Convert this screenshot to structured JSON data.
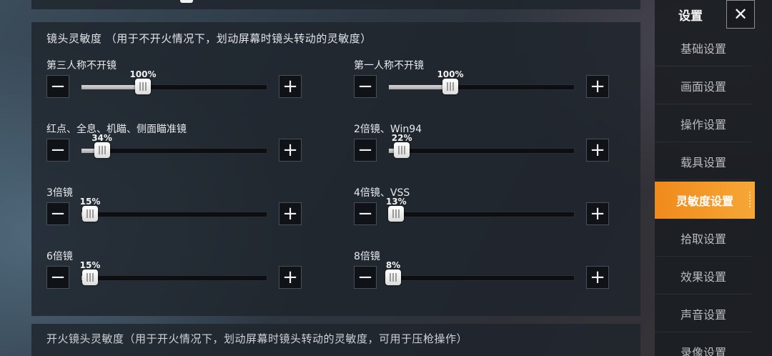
{
  "scope_section": {
    "title": "镜头灵敏度  （用于不开火情况下，划动屏幕时镜头转动的灵敏度）",
    "items": [
      {
        "label": "第三人称不开镜",
        "value": 100,
        "display": "100%"
      },
      {
        "label": "第一人称不开镜",
        "value": 100,
        "display": "100%"
      },
      {
        "label": "红点、全息、机瞄、侧面瞄准镜",
        "value": 34,
        "display": "34%"
      },
      {
        "label": "2倍镜、Win94",
        "value": 22,
        "display": "22%"
      },
      {
        "label": "3倍镜",
        "value": 15,
        "display": "15%"
      },
      {
        "label": "4倍镜、VSS",
        "value": 13,
        "display": "13%"
      },
      {
        "label": "6倍镜",
        "value": 15,
        "display": "15%"
      },
      {
        "label": "8倍镜",
        "value": 8,
        "display": "8%"
      }
    ],
    "max_value": 300
  },
  "fire_section": {
    "title": "开火镜头灵敏度（用于开火情况下，划动屏幕时镜头转动的灵敏度，可用于压枪操作）"
  },
  "sidebar": {
    "title": "设置",
    "items": [
      {
        "label": "基础设置",
        "active": false
      },
      {
        "label": "画面设置",
        "active": false
      },
      {
        "label": "操作设置",
        "active": false
      },
      {
        "label": "载具设置",
        "active": false
      },
      {
        "label": "灵敏度设置",
        "active": true
      },
      {
        "label": "拾取设置",
        "active": false
      },
      {
        "label": "效果设置",
        "active": false
      },
      {
        "label": "声音设置",
        "active": false
      },
      {
        "label": "录像设置",
        "active": false
      }
    ]
  },
  "colors": {
    "accent": "#f08a1c"
  },
  "icons": {
    "minus": "minus-icon",
    "plus": "plus-icon",
    "close": "close-icon"
  }
}
